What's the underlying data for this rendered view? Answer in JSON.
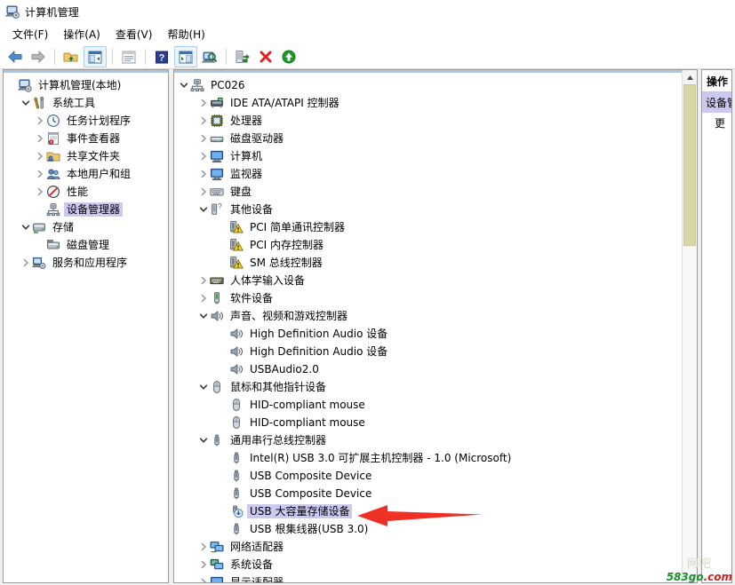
{
  "window": {
    "title": "计算机管理",
    "icon": "computer-management-icon"
  },
  "menubar": [
    {
      "label": "文件(F)",
      "name": "menu-file"
    },
    {
      "label": "操作(A)",
      "name": "menu-action"
    },
    {
      "label": "查看(V)",
      "name": "menu-view"
    },
    {
      "label": "帮助(H)",
      "name": "menu-help"
    }
  ],
  "toolbar": [
    {
      "name": "back-icon",
      "glyph": "back",
      "framed": false
    },
    {
      "name": "forward-icon",
      "glyph": "forward",
      "framed": false
    },
    {
      "name": "separator-1",
      "glyph": "sep",
      "framed": false
    },
    {
      "name": "up-folder-icon",
      "glyph": "folder",
      "framed": false
    },
    {
      "name": "show-hide-tree-icon",
      "glyph": "tree",
      "framed": true
    },
    {
      "name": "separator-2",
      "glyph": "sep",
      "framed": false
    },
    {
      "name": "properties-icon",
      "glyph": "props",
      "framed": false
    },
    {
      "name": "separator-3",
      "glyph": "sep",
      "framed": false
    },
    {
      "name": "help-icon",
      "glyph": "help",
      "framed": false
    },
    {
      "name": "show-action-pane-icon",
      "glyph": "actpane",
      "framed": true
    },
    {
      "name": "scan-hardware-icon",
      "glyph": "scan",
      "framed": false
    },
    {
      "name": "separator-4",
      "glyph": "sep",
      "framed": false
    },
    {
      "name": "update-driver-icon",
      "glyph": "update",
      "framed": false
    },
    {
      "name": "uninstall-device-icon",
      "glyph": "x",
      "framed": false
    },
    {
      "name": "enable-device-icon",
      "glyph": "uparrow",
      "framed": false
    }
  ],
  "console_tree": {
    "items": [
      {
        "label": "计算机管理(本地)",
        "indent": 0,
        "chev": "none",
        "icon": "computer-management-icon",
        "selected": false,
        "name": "tree-item-computer-management-local"
      },
      {
        "label": "系统工具",
        "indent": 1,
        "chev": "expanded",
        "icon": "system-tools-icon",
        "selected": false,
        "name": "tree-item-system-tools"
      },
      {
        "label": "任务计划程序",
        "indent": 2,
        "chev": "collapsed",
        "icon": "task-scheduler-icon",
        "selected": false,
        "name": "tree-item-task-scheduler"
      },
      {
        "label": "事件查看器",
        "indent": 2,
        "chev": "collapsed",
        "icon": "event-viewer-icon",
        "selected": false,
        "name": "tree-item-event-viewer"
      },
      {
        "label": "共享文件夹",
        "indent": 2,
        "chev": "collapsed",
        "icon": "shared-folders-icon",
        "selected": false,
        "name": "tree-item-shared-folders"
      },
      {
        "label": "本地用户和组",
        "indent": 2,
        "chev": "collapsed",
        "icon": "local-users-groups-icon",
        "selected": false,
        "name": "tree-item-local-users-and-groups"
      },
      {
        "label": "性能",
        "indent": 2,
        "chev": "collapsed",
        "icon": "performance-icon",
        "selected": false,
        "name": "tree-item-performance"
      },
      {
        "label": "设备管理器",
        "indent": 2,
        "chev": "none",
        "icon": "device-manager-icon",
        "selected": true,
        "name": "tree-item-device-manager"
      },
      {
        "label": "存储",
        "indent": 1,
        "chev": "expanded",
        "icon": "storage-icon",
        "selected": false,
        "name": "tree-item-storage"
      },
      {
        "label": "磁盘管理",
        "indent": 2,
        "chev": "none",
        "icon": "disk-management-icon",
        "selected": false,
        "name": "tree-item-disk-management"
      },
      {
        "label": "服务和应用程序",
        "indent": 1,
        "chev": "collapsed",
        "icon": "services-apps-icon",
        "selected": false,
        "name": "tree-item-services-and-applications"
      }
    ]
  },
  "device_tree": {
    "items": [
      {
        "label": "PC026",
        "indent": 0,
        "chev": "expanded",
        "icon": "computer-icon",
        "selected": false,
        "name": "device-node-pc026"
      },
      {
        "label": "IDE ATA/ATAPI 控制器",
        "indent": 1,
        "chev": "collapsed",
        "icon": "ide-controller-icon",
        "selected": false,
        "name": "device-node-ide-ata-atapi"
      },
      {
        "label": "处理器",
        "indent": 1,
        "chev": "collapsed",
        "icon": "processor-icon",
        "selected": false,
        "name": "device-node-processors"
      },
      {
        "label": "磁盘驱动器",
        "indent": 1,
        "chev": "collapsed",
        "icon": "diskdrive-icon",
        "selected": false,
        "name": "device-node-disk-drives"
      },
      {
        "label": "计算机",
        "indent": 1,
        "chev": "collapsed",
        "icon": "monitor-blue-icon",
        "selected": false,
        "name": "device-node-computer"
      },
      {
        "label": "监视器",
        "indent": 1,
        "chev": "collapsed",
        "icon": "monitor-blue-icon",
        "selected": false,
        "name": "device-node-monitors"
      },
      {
        "label": "键盘",
        "indent": 1,
        "chev": "collapsed",
        "icon": "keyboard-icon",
        "selected": false,
        "name": "device-node-keyboards"
      },
      {
        "label": "其他设备",
        "indent": 1,
        "chev": "expanded",
        "icon": "other-devices-icon",
        "selected": false,
        "name": "device-node-other-devices"
      },
      {
        "label": "PCI 简单通讯控制器",
        "indent": 2,
        "chev": "none",
        "icon": "warning-device-icon",
        "selected": false,
        "name": "device-node-pci-simple-comm"
      },
      {
        "label": "PCI 内存控制器",
        "indent": 2,
        "chev": "none",
        "icon": "warning-device-icon",
        "selected": false,
        "name": "device-node-pci-memory"
      },
      {
        "label": "SM 总线控制器",
        "indent": 2,
        "chev": "none",
        "icon": "warning-device-icon",
        "selected": false,
        "name": "device-node-sm-bus"
      },
      {
        "label": "人体学输入设备",
        "indent": 1,
        "chev": "collapsed",
        "icon": "hid-icon",
        "selected": false,
        "name": "device-node-hid"
      },
      {
        "label": "软件设备",
        "indent": 1,
        "chev": "collapsed",
        "icon": "software-device-icon",
        "selected": false,
        "name": "device-node-software-devices"
      },
      {
        "label": "声音、视频和游戏控制器",
        "indent": 1,
        "chev": "expanded",
        "icon": "speaker-icon",
        "selected": false,
        "name": "device-node-sound-video-game"
      },
      {
        "label": "High Definition Audio 设备",
        "indent": 2,
        "chev": "none",
        "icon": "speaker-icon",
        "selected": false,
        "name": "device-node-hd-audio-1"
      },
      {
        "label": "High Definition Audio 设备",
        "indent": 2,
        "chev": "none",
        "icon": "speaker-icon",
        "selected": false,
        "name": "device-node-hd-audio-2"
      },
      {
        "label": "USBAudio2.0",
        "indent": 2,
        "chev": "none",
        "icon": "speaker-icon",
        "selected": false,
        "name": "device-node-usbaudio20"
      },
      {
        "label": "鼠标和其他指针设备",
        "indent": 1,
        "chev": "expanded",
        "icon": "mouse-icon",
        "selected": false,
        "name": "device-node-mice"
      },
      {
        "label": "HID-compliant mouse",
        "indent": 2,
        "chev": "none",
        "icon": "mouse-icon",
        "selected": false,
        "name": "device-node-hid-mouse-1"
      },
      {
        "label": "HID-compliant mouse",
        "indent": 2,
        "chev": "none",
        "icon": "mouse-icon",
        "selected": false,
        "name": "device-node-hid-mouse-2"
      },
      {
        "label": "通用串行总线控制器",
        "indent": 1,
        "chev": "expanded",
        "icon": "usb-icon",
        "selected": false,
        "name": "device-node-usb-controllers"
      },
      {
        "label": "Intel(R) USB 3.0 可扩展主机控制器 - 1.0 (Microsoft)",
        "indent": 2,
        "chev": "none",
        "icon": "usb-icon",
        "selected": false,
        "name": "device-node-intel-usb30-host"
      },
      {
        "label": "USB Composite Device",
        "indent": 2,
        "chev": "none",
        "icon": "usb-icon",
        "selected": false,
        "name": "device-node-usb-composite-1"
      },
      {
        "label": "USB Composite Device",
        "indent": 2,
        "chev": "none",
        "icon": "usb-icon",
        "selected": false,
        "name": "device-node-usb-composite-2"
      },
      {
        "label": "USB 大容量存储设备",
        "indent": 2,
        "chev": "none",
        "icon": "usb-mass-storage-icon",
        "selected": true,
        "name": "device-node-usb-mass-storage"
      },
      {
        "label": "USB 根集线器(USB 3.0)",
        "indent": 2,
        "chev": "none",
        "icon": "usb-icon",
        "selected": false,
        "name": "device-node-usb-root-hub"
      },
      {
        "label": "网络适配器",
        "indent": 1,
        "chev": "collapsed",
        "icon": "network-icon",
        "selected": false,
        "name": "device-node-network-adapters"
      },
      {
        "label": "系统设备",
        "indent": 1,
        "chev": "collapsed",
        "icon": "system-device-icon",
        "selected": false,
        "name": "device-node-system-devices"
      },
      {
        "label": "显示适配器",
        "indent": 1,
        "chev": "collapsed",
        "icon": "monitor-blue-icon",
        "selected": false,
        "name": "device-node-display-adapters"
      }
    ]
  },
  "actions_pane": {
    "header": "操作",
    "selected_item": "设备管",
    "sub_item": "更"
  },
  "annotation": {
    "arrow_color": "#ee3124",
    "points_at": "device-node-usb-mass-storage"
  },
  "watermark": {
    "cn": "网吧",
    "domain_main": "583go",
    "domain_tld": ".com"
  },
  "colors": {
    "selection": "#cbc9f0",
    "scrollbar_thumb": "#d9d6a5",
    "pane_border": "#9a9a9a",
    "accent_top": "#a8c8e8"
  }
}
